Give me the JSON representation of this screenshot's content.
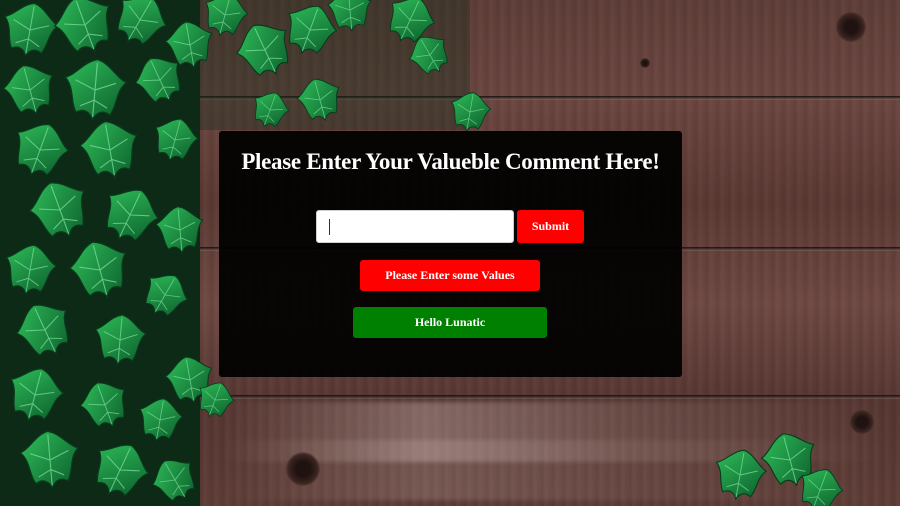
{
  "form": {
    "title": "Please Enter Your Valueble Comment Here!",
    "input_value": "",
    "input_placeholder": "",
    "submit_label": "Submit",
    "error_label": "Please Enter some Values",
    "greeting_label": "Hello Lunatic"
  },
  "colors": {
    "panel": "#000000",
    "submit": "#ff0000",
    "error": "#ff0000",
    "greeting": "#008000",
    "title_text": "#ffffff"
  },
  "background": {
    "description_icon": "wood-plank-background",
    "foliage_icon": "ivy-leaves-decoration"
  }
}
